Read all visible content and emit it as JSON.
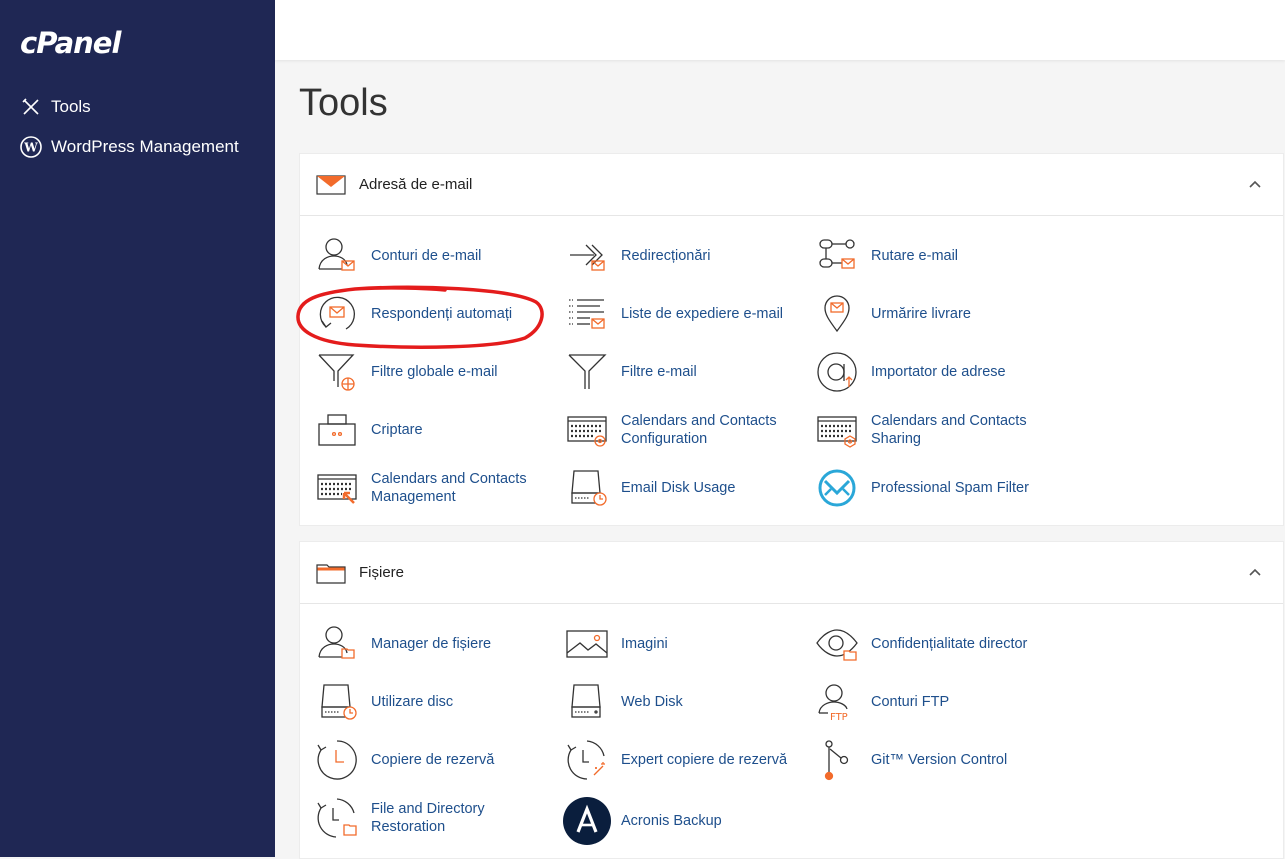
{
  "sidebar": {
    "logo": "cPanel",
    "items": [
      {
        "label": "Tools",
        "icon": "tools-icon"
      },
      {
        "label": "WordPress Management",
        "icon": "wordpress-icon"
      }
    ]
  },
  "page": {
    "title": "Tools"
  },
  "colors": {
    "sidebar": "#1f2754",
    "link": "#1e4f8c",
    "accent": "#f26b2b",
    "annotation": "#e41c1c"
  },
  "sections": [
    {
      "title": "Adresă de e-mail",
      "icon": "envelope-icon",
      "tools": [
        {
          "label": "Conturi de e-mail",
          "icon": "email-accounts-icon"
        },
        {
          "label": "Redirecționări",
          "icon": "forwarders-icon"
        },
        {
          "label": "Rutare e-mail",
          "icon": "email-routing-icon"
        },
        {
          "label": "Respondenți automați",
          "icon": "autoresponders-icon"
        },
        {
          "label": "Liste de expediere e-mail",
          "icon": "mailing-lists-icon"
        },
        {
          "label": "Urmărire livrare",
          "icon": "track-delivery-icon"
        },
        {
          "label": "Filtre globale e-mail",
          "icon": "global-filters-icon"
        },
        {
          "label": "Filtre e-mail",
          "icon": "email-filters-icon"
        },
        {
          "label": "Importator de adrese",
          "icon": "address-importer-icon"
        },
        {
          "label": "Criptare",
          "icon": "encryption-icon"
        },
        {
          "label": "Calendars and Contacts Configuration",
          "icon": "calendar-config-icon"
        },
        {
          "label": "Calendars and Contacts Sharing",
          "icon": "calendar-sharing-icon"
        },
        {
          "label": "Calendars and Contacts Management",
          "icon": "calendar-management-icon"
        },
        {
          "label": "Email Disk Usage",
          "icon": "email-disk-usage-icon"
        },
        {
          "label": "Professional Spam Filter",
          "icon": "spam-filter-icon"
        }
      ]
    },
    {
      "title": "Fișiere",
      "icon": "folder-icon",
      "tools": [
        {
          "label": "Manager de fișiere",
          "icon": "file-manager-icon"
        },
        {
          "label": "Imagini",
          "icon": "images-icon"
        },
        {
          "label": "Confidențialitate director",
          "icon": "directory-privacy-icon"
        },
        {
          "label": "Utilizare disc",
          "icon": "disk-usage-icon"
        },
        {
          "label": "Web Disk",
          "icon": "web-disk-icon"
        },
        {
          "label": "Conturi FTP",
          "icon": "ftp-accounts-icon"
        },
        {
          "label": "Copiere de rezervă",
          "icon": "backup-icon"
        },
        {
          "label": "Expert copiere de rezervă",
          "icon": "backup-wizard-icon"
        },
        {
          "label": "Git™ Version Control",
          "icon": "git-icon"
        },
        {
          "label": "File and Directory Restoration",
          "icon": "file-restoration-icon"
        },
        {
          "label": "Acronis Backup",
          "icon": "acronis-icon"
        }
      ]
    }
  ]
}
